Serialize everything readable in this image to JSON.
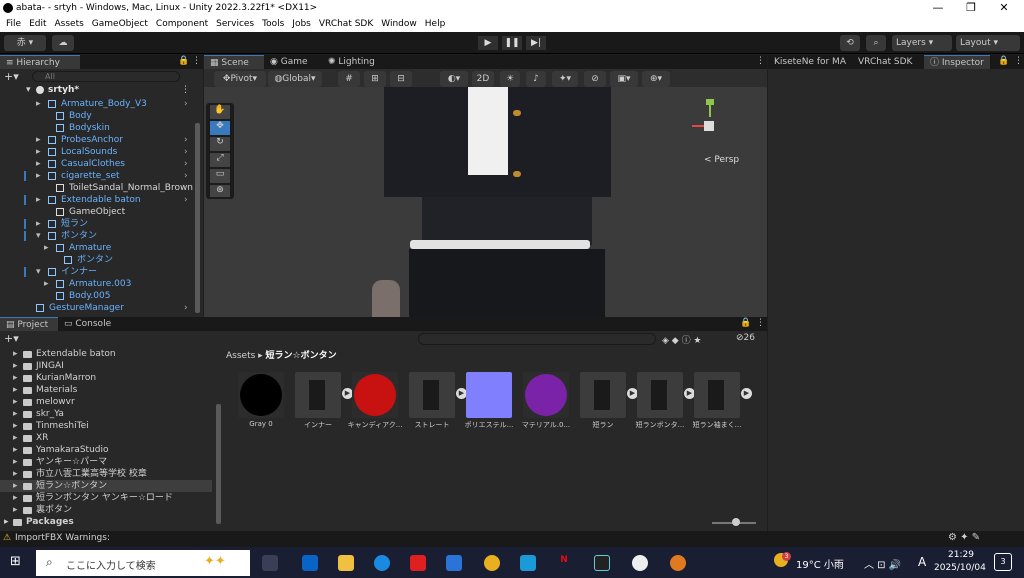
{
  "window": {
    "title": "abata- - srtyh - Windows, Mac, Linux - Unity 2022.3.22f1* <DX11>",
    "min": "—",
    "max": "❐",
    "close": "✕"
  },
  "menu": [
    "File",
    "Edit",
    "Assets",
    "GameObject",
    "Component",
    "Services",
    "Tools",
    "Jobs",
    "VRChat SDK",
    "Window",
    "Help"
  ],
  "toolbar": {
    "account": "赤 ▾",
    "layers": "Layers",
    "layout": "Layout"
  },
  "hierarchy": {
    "tab": "Hierarchy",
    "search_placeholder": "All",
    "scene": "srtyh*",
    "items": [
      {
        "label": "Armature_Body_V3",
        "blue": true
      },
      {
        "label": "Body",
        "blue": true
      },
      {
        "label": "Bodyskin",
        "blue": true
      },
      {
        "label": "ProbesAnchor",
        "blue": true
      },
      {
        "label": "LocalSounds",
        "blue": true
      },
      {
        "label": "CasualClothes",
        "blue": true
      },
      {
        "label": "cigarette_set",
        "blue": true
      },
      {
        "label": "ToiletSandal_Normal_Brown",
        "blue": false
      },
      {
        "label": "Extendable baton",
        "blue": true
      },
      {
        "label": "GameObject",
        "blue": false
      },
      {
        "label": "短ラン",
        "blue": true
      },
      {
        "label": "ボンタン",
        "blue": true
      },
      {
        "label": "Armature",
        "blue": true
      },
      {
        "label": "ボンタン",
        "blue": true
      },
      {
        "label": "インナー",
        "blue": true
      },
      {
        "label": "Armature.003",
        "blue": true
      },
      {
        "label": "Body.005",
        "blue": true
      },
      {
        "label": "GestureManager",
        "blue": true
      }
    ]
  },
  "scene": {
    "tabs": [
      "Scene",
      "Game",
      "Lighting"
    ],
    "pivot": "Pivot",
    "global": "Global",
    "twod": "2D",
    "persp": "< Persp"
  },
  "inspector": {
    "tabs": [
      "KiseteNe for MA",
      "VRChat SDK",
      "Inspector"
    ]
  },
  "project": {
    "tabs": [
      "Project",
      "Console"
    ],
    "count": "26",
    "folders": [
      "Extendable baton",
      "JINGAI",
      "KurianMarron",
      "Materials",
      "melowvr",
      "skr_Ya",
      "TinmeshiTei",
      "XR",
      "YamakaraStudio",
      "ヤンキー☆パーマ",
      "市立八雲工業高等学校 校章",
      "短ラン☆ボンタン",
      "短ランボンタン ヤンキー☆ロード",
      "裏ボタン"
    ],
    "packages": "Packages",
    "breadcrumb_root": "Assets",
    "breadcrumb_leaf": "短ラン☆ボンタン",
    "assets": [
      {
        "label": "Gray 0",
        "color": "#000000",
        "round": true,
        "arrow": false
      },
      {
        "label": "インナー",
        "color": "#3c3c3c",
        "round": false,
        "arrow": true
      },
      {
        "label": "キャンディアク...",
        "color": "#c81212",
        "round": true,
        "arrow": false
      },
      {
        "label": "ストレート",
        "color": "#3c3c3c",
        "round": false,
        "arrow": true
      },
      {
        "label": "ポリエステル...",
        "color": "#8080ff",
        "round": false,
        "arrow": false
      },
      {
        "label": "マテリアル.0...",
        "color": "#7a22a8",
        "round": true,
        "arrow": false
      },
      {
        "label": "短ラン",
        "color": "#3c3c3c",
        "round": false,
        "arrow": true
      },
      {
        "label": "短ランボンタ...",
        "color": "#3c3c3c",
        "round": false,
        "arrow": true
      },
      {
        "label": "短ラン袖まく...",
        "color": "#3c3c3c",
        "round": false,
        "arrow": true
      }
    ]
  },
  "status": {
    "warning": "ImportFBX Warnings:"
  },
  "taskbar": {
    "search": "ここに入力して検索",
    "weather": "19°C 小雨",
    "ime": "A",
    "time": "21:29",
    "date": "2025/10/04",
    "badge": "3"
  }
}
